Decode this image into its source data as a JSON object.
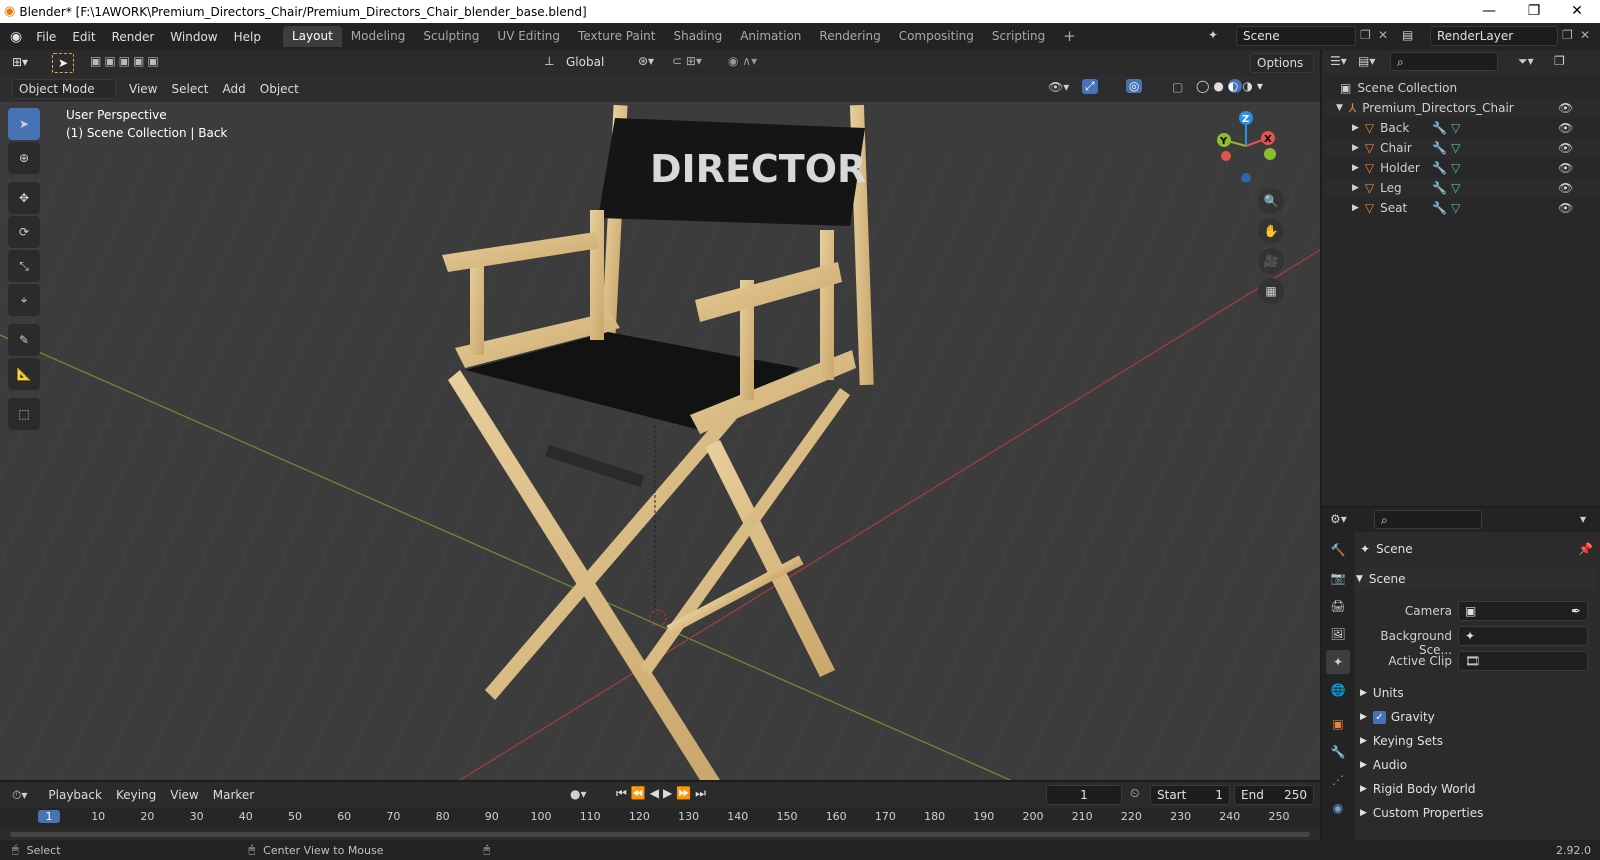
{
  "title": "Blender* [F:\\1AWORK\\Premium_Directors_Chair/Premium_Directors_Chair_blender_base.blend]",
  "menus": [
    "File",
    "Edit",
    "Render",
    "Window",
    "Help"
  ],
  "workspaces": [
    "Layout",
    "Modeling",
    "Sculpting",
    "UV Editing",
    "Texture Paint",
    "Shading",
    "Animation",
    "Rendering",
    "Compositing",
    "Scripting"
  ],
  "scene_name": "Scene",
  "view_layer": "RenderLayer",
  "options_label": "Options",
  "orientation": "Global",
  "viewport": {
    "mode": "Object Mode",
    "menus": [
      "View",
      "Select",
      "Add",
      "Object"
    ],
    "perspective": "User Perspective",
    "collection_info": "(1) Scene Collection | Back",
    "chair_text": "DIRECTOR"
  },
  "gizmo": {
    "z": "Z",
    "y": "Y",
    "x": "X"
  },
  "outliner": {
    "root": "Scene Collection",
    "collection": "Premium_Directors_Chair",
    "objects": [
      "Back",
      "Chair",
      "Holder",
      "Leg",
      "Seat"
    ]
  },
  "properties": {
    "header": "Scene",
    "panel": "Scene",
    "camera_label": "Camera",
    "bg_scene_label": "Background Sce...",
    "active_clip_label": "Active Clip",
    "sections": [
      "Units",
      "Gravity",
      "Keying Sets",
      "Audio",
      "Rigid Body World",
      "Custom Properties"
    ]
  },
  "timeline": {
    "menus": [
      "Playback",
      "Keying",
      "View",
      "Marker"
    ],
    "current_frame": "1",
    "start_label": "Start",
    "start": "1",
    "end_label": "End",
    "end": "250",
    "ticks": [
      "1",
      "10",
      "20",
      "30",
      "40",
      "50",
      "60",
      "70",
      "80",
      "90",
      "100",
      "110",
      "120",
      "130",
      "140",
      "150",
      "160",
      "170",
      "180",
      "190",
      "200",
      "210",
      "220",
      "230",
      "240",
      "250"
    ]
  },
  "status": {
    "select": "Select",
    "center": "Center View to Mouse",
    "version": "2.92.0"
  },
  "colors": {
    "accent": "#4772b3",
    "x_axis": "#e3534f",
    "y_axis": "#8bbd2f",
    "z_axis": "#2c8fe6"
  }
}
